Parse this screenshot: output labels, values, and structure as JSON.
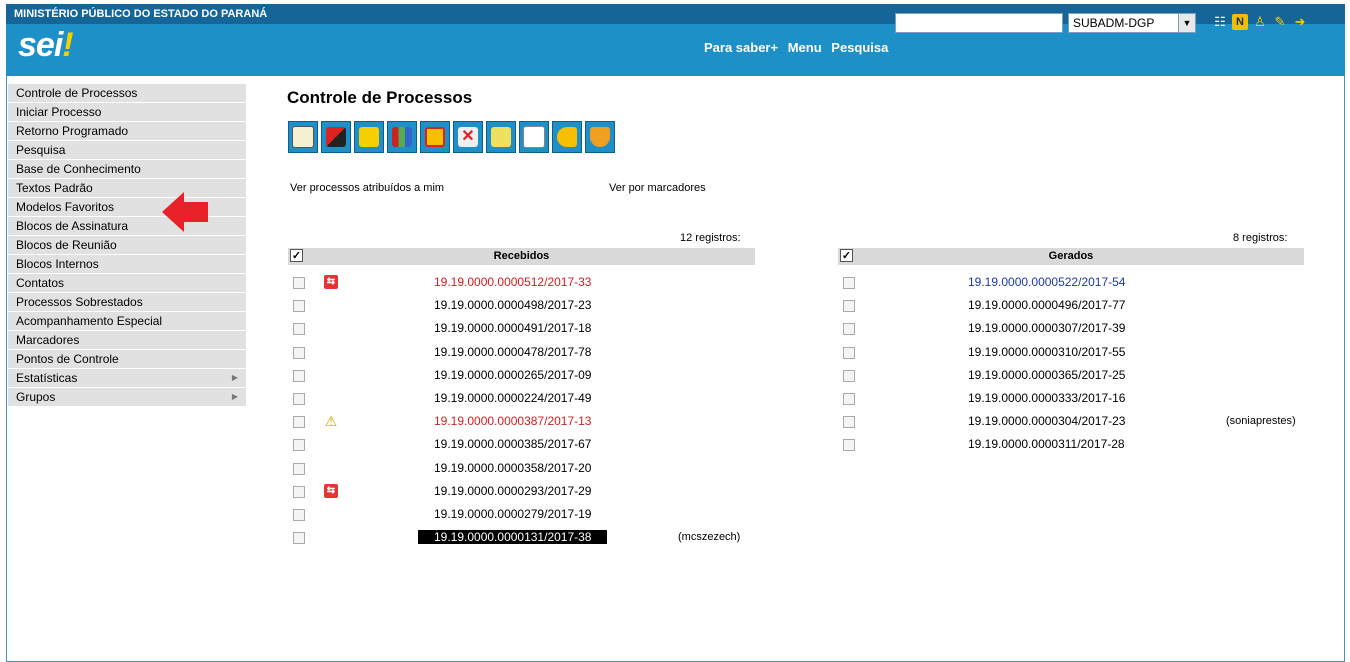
{
  "top_bar": {
    "org": "MINISTÉRIO PÚBLICO DO ESTADO DO PARANÁ"
  },
  "header": {
    "logo_text": "sei",
    "logo_bang": "!",
    "links": [
      "Para saber+",
      "Menu",
      "Pesquisa"
    ],
    "search_value": "",
    "unit_selected": "SUBADM-DGP"
  },
  "menu": [
    {
      "label": "Controle de Processos",
      "submenu": false
    },
    {
      "label": "Iniciar Processo",
      "submenu": false
    },
    {
      "label": "Retorno Programado",
      "submenu": false
    },
    {
      "label": "Pesquisa",
      "submenu": false
    },
    {
      "label": "Base de Conhecimento",
      "submenu": false
    },
    {
      "label": "Textos Padrão",
      "submenu": false
    },
    {
      "label": "Modelos Favoritos",
      "submenu": false
    },
    {
      "label": "Blocos de Assinatura",
      "submenu": false
    },
    {
      "label": "Blocos de Reunião",
      "submenu": false
    },
    {
      "label": "Blocos Internos",
      "submenu": false
    },
    {
      "label": "Contatos",
      "submenu": false
    },
    {
      "label": "Processos Sobrestados",
      "submenu": false
    },
    {
      "label": "Acompanhamento Especial",
      "submenu": false
    },
    {
      "label": "Marcadores",
      "submenu": false
    },
    {
      "label": "Pontos de Controle",
      "submenu": false
    },
    {
      "label": "Estatísticas",
      "submenu": true
    },
    {
      "label": "Grupos",
      "submenu": true
    }
  ],
  "main": {
    "title": "Controle de Processos",
    "toolbar_icons": [
      "envelope-doc-icon",
      "send-process-icon",
      "assign-person-icon",
      "books-icon",
      "pause-icon",
      "remove-x-icon",
      "notes-icon",
      "new-document-icon",
      "tag-icon",
      "shield-icon"
    ],
    "link_assigned": "Ver processos atribuídos a mim",
    "link_markers": "Ver por marcadores",
    "received": {
      "count": "12 registros:",
      "header": "Recebidos",
      "check_glyph": "✓",
      "rows": [
        {
          "num": "19.19.0000.0000512/2017-33",
          "style": "red",
          "icon": "⇆",
          "icon_type": "red",
          "user": ""
        },
        {
          "num": "19.19.0000.0000498/2017-23",
          "style": "",
          "icon": "",
          "icon_type": "",
          "user": ""
        },
        {
          "num": "19.19.0000.0000491/2017-18",
          "style": "",
          "icon": "",
          "icon_type": "",
          "user": ""
        },
        {
          "num": "19.19.0000.0000478/2017-78",
          "style": "",
          "icon": "",
          "icon_type": "",
          "user": ""
        },
        {
          "num": "19.19.0000.0000265/2017-09",
          "style": "",
          "icon": "",
          "icon_type": "",
          "user": ""
        },
        {
          "num": "19.19.0000.0000224/2017-49",
          "style": "",
          "icon": "",
          "icon_type": "",
          "user": ""
        },
        {
          "num": "19.19.0000.0000387/2017-13",
          "style": "red",
          "icon": "⚠",
          "icon_type": "warn",
          "user": ""
        },
        {
          "num": "19.19.0000.0000385/2017-67",
          "style": "",
          "icon": "",
          "icon_type": "",
          "user": ""
        },
        {
          "num": "19.19.0000.0000358/2017-20",
          "style": "",
          "icon": "",
          "icon_type": "",
          "user": ""
        },
        {
          "num": "19.19.0000.0000293/2017-29",
          "style": "",
          "icon": "⇆",
          "icon_type": "red",
          "user": ""
        },
        {
          "num": "19.19.0000.0000279/2017-19",
          "style": "",
          "icon": "",
          "icon_type": "",
          "user": ""
        },
        {
          "num": "19.19.0000.0000131/2017-38",
          "style": "sel",
          "icon": "",
          "icon_type": "",
          "user": "(mcszezech)"
        }
      ]
    },
    "generated": {
      "count": "8 registros:",
      "header": "Gerados",
      "check_glyph": "✓",
      "rows": [
        {
          "num": "19.19.0000.0000522/2017-54",
          "style": "blue",
          "user": ""
        },
        {
          "num": "19.19.0000.0000496/2017-77",
          "style": "",
          "user": ""
        },
        {
          "num": "19.19.0000.0000307/2017-39",
          "style": "",
          "user": ""
        },
        {
          "num": "19.19.0000.0000310/2017-55",
          "style": "",
          "user": ""
        },
        {
          "num": "19.19.0000.0000365/2017-25",
          "style": "",
          "user": ""
        },
        {
          "num": "19.19.0000.0000333/2017-16",
          "style": "",
          "user": ""
        },
        {
          "num": "19.19.0000.0000304/2017-23",
          "style": "",
          "user": "(soniaprestes)"
        },
        {
          "num": "19.19.0000.0000311/2017-28",
          "style": "",
          "user": ""
        }
      ]
    }
  },
  "colors": {
    "top_bar": "#156599",
    "header": "#1e90c8",
    "menu_bg": "#e1e1e1",
    "alert_red": "#d21e1e",
    "link_blue": "#1a3aa0",
    "arrow": "#e8202a"
  }
}
